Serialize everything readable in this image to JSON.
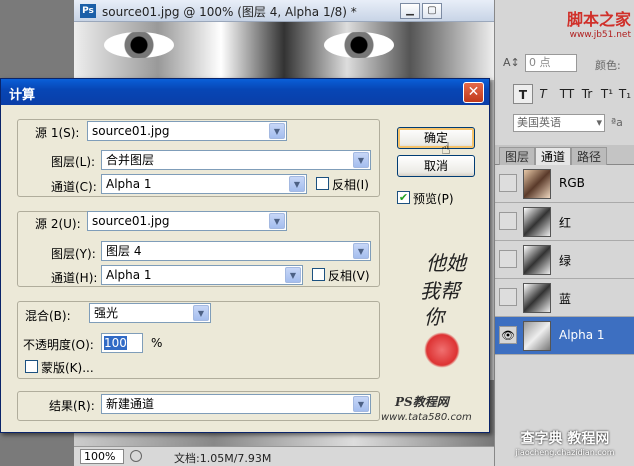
{
  "doc_window": {
    "title": "source01.jpg @ 100% (图层 4, Alpha 1/8) *",
    "ps_icon": "Ps",
    "zoom": "100%",
    "doc_info": "文档:1.05M/7.93M"
  },
  "watermark_top": {
    "text1": "脚本之家",
    "text2": "www.jb51.net"
  },
  "char_panel": {
    "field1": "0 点",
    "color_label": "颜色:",
    "lang": "美国英语",
    "aa": "ªa",
    "btns": [
      "T",
      "T",
      "TT",
      "Tr",
      "T¹",
      "T₁"
    ]
  },
  "channels_panel": {
    "tabs": [
      "图层",
      "通道",
      "路径"
    ],
    "active_tab": "通道",
    "rows": [
      {
        "label": "RGB",
        "thumb": "rgb",
        "selected": false,
        "eye": ""
      },
      {
        "label": "红",
        "thumb": "gray",
        "selected": false,
        "eye": ""
      },
      {
        "label": "绿",
        "thumb": "gray",
        "selected": false,
        "eye": ""
      },
      {
        "label": "蓝",
        "thumb": "gray",
        "selected": false,
        "eye": ""
      },
      {
        "label": "Alpha 1",
        "thumb": "alpha",
        "selected": true,
        "eye": "👁"
      }
    ]
  },
  "dialog": {
    "title": "计算",
    "source1": {
      "label": "源 1(S):",
      "value": "source01.jpg",
      "layer_label": "图层(L):",
      "layer_value": "合并图层",
      "channel_label": "通道(C):",
      "channel_value": "Alpha 1",
      "invert_label": "反相(I)"
    },
    "source2": {
      "label": "源 2(U):",
      "value": "source01.jpg",
      "layer_label": "图层(Y):",
      "layer_value": "图层 4",
      "channel_label": "通道(H):",
      "channel_value": "Alpha 1",
      "invert_label": "反相(V)"
    },
    "blend": {
      "label": "混合(B):",
      "value": "强光",
      "opacity_label": "不透明度(O):",
      "opacity_value": "100",
      "opacity_unit": "%",
      "mask_label": "蒙版(K)..."
    },
    "result": {
      "label": "结果(R):",
      "value": "新建通道"
    },
    "ok": "确定",
    "cancel": "取消",
    "preview": "预览(P)",
    "preview_checked": true,
    "decor": {
      "sig1": "他她",
      "sig2": "我帮",
      "sig3": "你",
      "brand": "PS教程网",
      "url": "www.tata580.com"
    }
  },
  "watermark_bottom": {
    "text1": "查字典 教程网",
    "text2": "jiaocheng.chazidian.com"
  }
}
